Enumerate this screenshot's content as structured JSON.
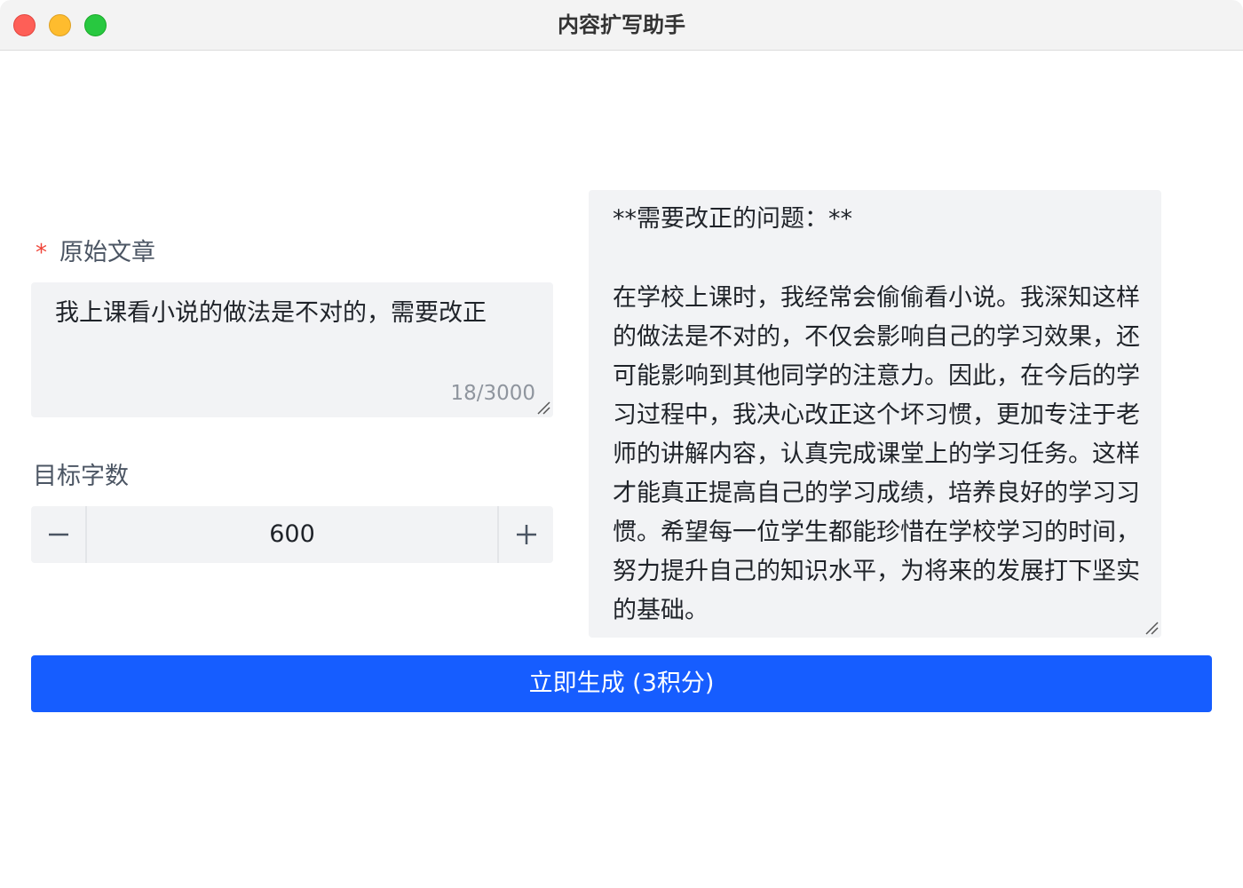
{
  "window": {
    "title": "内容扩写助手"
  },
  "form": {
    "original_label": "原始文章",
    "required_mark": "*",
    "original_value": "我上课看小说的做法是不对的，需要改正",
    "char_count": "18/3000",
    "target_label": "目标字数",
    "target_value": "600",
    "minus_symbol": "−",
    "plus_symbol": "+"
  },
  "output": {
    "heading": "**需要改正的问题：**",
    "body": "在学校上课时，我经常会偷偷看小说。我深知这样的做法是不对的，不仅会影响自己的学习效果，还可能影响到其他同学的注意力。因此，在今后的学习过程中，我决心改正这个坏习惯，更加专注于老师的讲解内容，认真完成课堂上的学习任务。这样才能真正提高自己的学习成绩，培养良好的学习习惯。希望每一位学生都能珍惜在学校学习的时间，努力提升自己的知识水平，为将来的发展打下坚实的基础。"
  },
  "actions": {
    "generate_label": "立即生成 (3积分)"
  },
  "colors": {
    "primary": "#165dff",
    "required": "#f04438",
    "field_bg": "#f2f3f5"
  }
}
